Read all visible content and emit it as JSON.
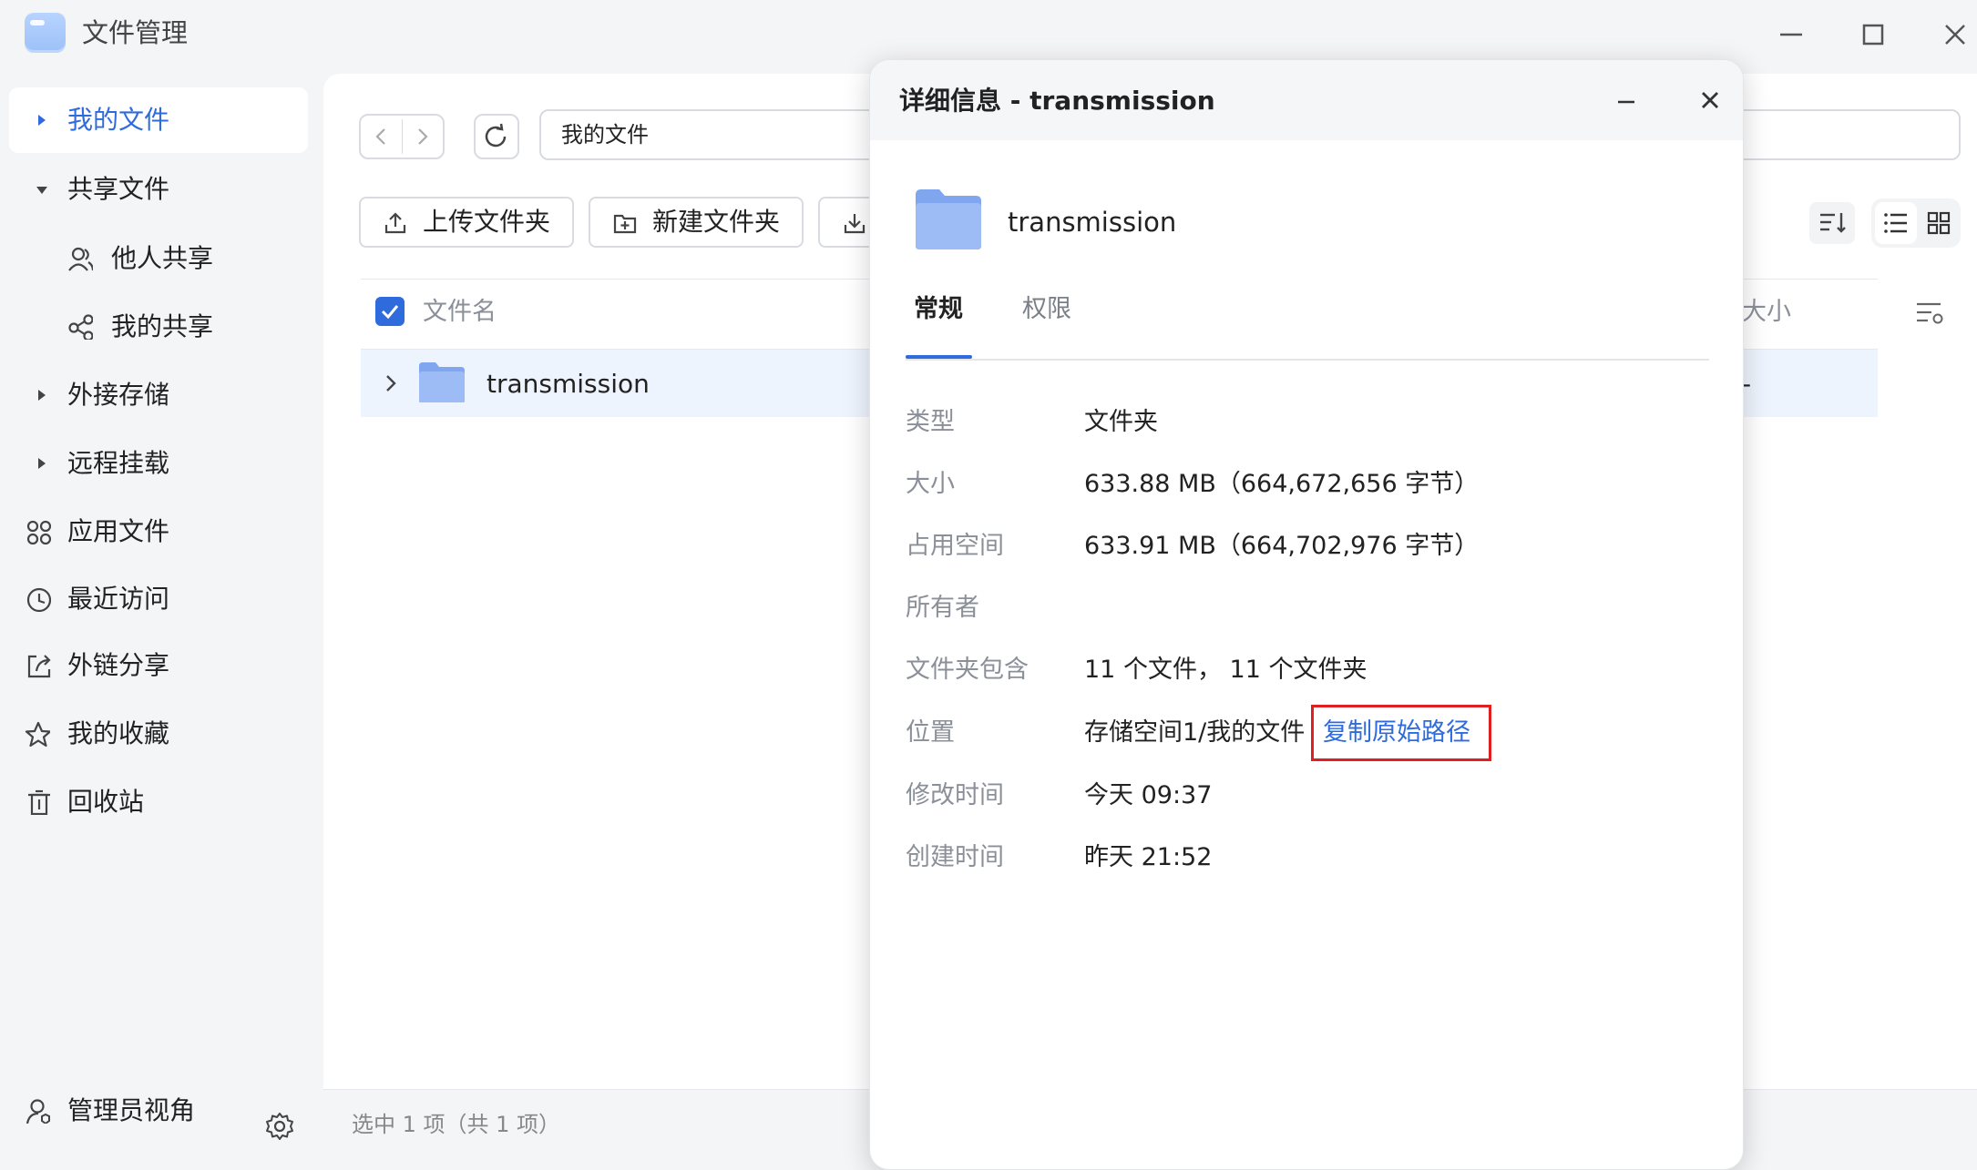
{
  "window": {
    "title": "文件管理"
  },
  "sidebar": {
    "items": [
      {
        "label": "我的文件",
        "active": true
      },
      {
        "label": "共享文件"
      },
      {
        "label": "他人共享"
      },
      {
        "label": "我的共享"
      },
      {
        "label": "外接存储"
      },
      {
        "label": "远程挂载"
      },
      {
        "label": "应用文件"
      },
      {
        "label": "最近访问"
      },
      {
        "label": "外链分享"
      },
      {
        "label": "我的收藏"
      },
      {
        "label": "回收站"
      }
    ],
    "footer_label": "管理员视角"
  },
  "toolbar": {
    "path": "我的文件",
    "upload_label": "上传文件夹",
    "new_folder_label": "新建文件夹"
  },
  "table": {
    "col_name": "文件名",
    "col_size": "大小",
    "rows": [
      {
        "name": "transmission",
        "size": "-"
      }
    ]
  },
  "status": "选中 1 项（共 1 项）",
  "dialog": {
    "title": "详细信息 - transmission",
    "item_name": "transmission",
    "tabs": [
      "常规",
      "权限"
    ],
    "props": [
      {
        "label": "类型",
        "value": "文件夹"
      },
      {
        "label": "大小",
        "value": "633.88 MB（664,672,656 字节）"
      },
      {
        "label": "占用空间",
        "value": "633.91 MB（664,702,976 字节）"
      },
      {
        "label": "所有者",
        "value": ""
      },
      {
        "label": "文件夹包含",
        "value": "11 个文件， 11 个文件夹"
      },
      {
        "label": "位置",
        "value": "存储空间1/我的文件"
      },
      {
        "label": "修改时间",
        "value": "今天 09:37"
      },
      {
        "label": "创建时间",
        "value": "昨天 21:52"
      }
    ],
    "copy_link": "复制原始路径"
  },
  "colors": {
    "accent": "#2f6bdc",
    "highlight_border": "#e02020",
    "folder": "#8fb3f2"
  }
}
